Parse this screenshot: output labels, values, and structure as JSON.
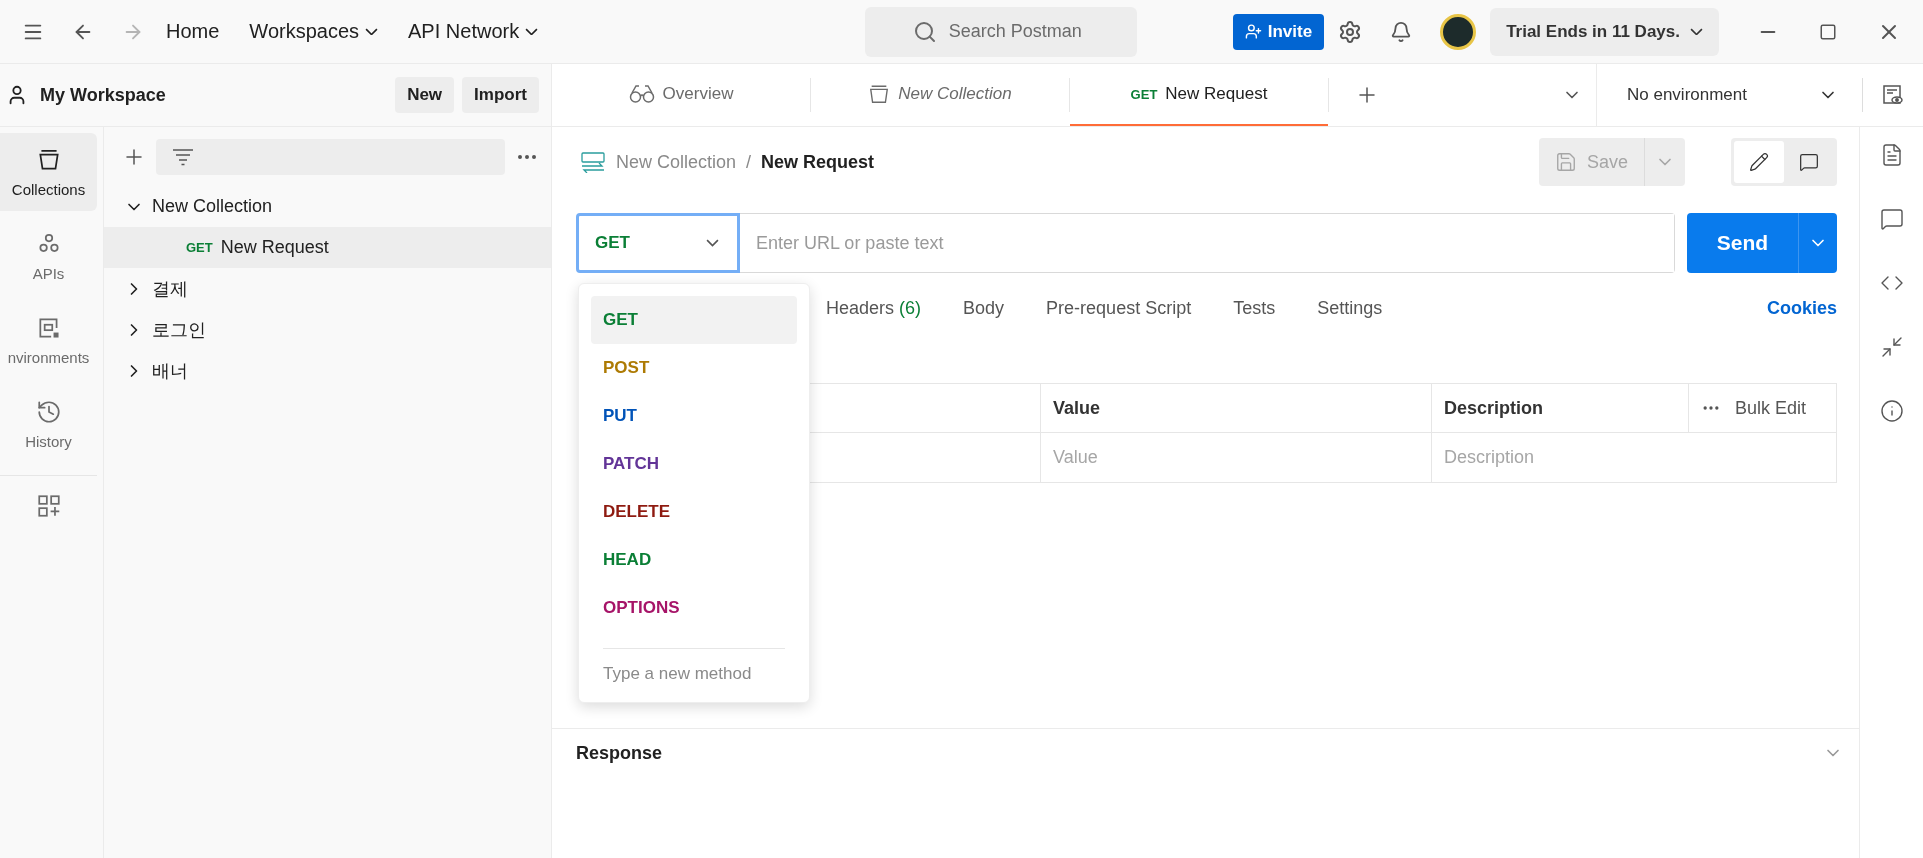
{
  "topbar": {
    "history_nav": [
      {
        "kind": "back",
        "disabled": false
      },
      {
        "kind": "forward",
        "disabled": true
      }
    ],
    "nav": [
      {
        "label": "Home",
        "dropdown": false
      },
      {
        "label": "Workspaces",
        "dropdown": true
      },
      {
        "label": "API Network",
        "dropdown": true
      }
    ],
    "search": {
      "placeholder": "Search Postman"
    },
    "invite": "Invite",
    "trial": "Trial Ends in 11 Days."
  },
  "workspace": {
    "title": "My Workspace",
    "buttons": [
      "New",
      "Import"
    ]
  },
  "rail": [
    {
      "kind": "collections",
      "label": "Collections",
      "selected": true
    },
    {
      "kind": "apis",
      "label": "APIs",
      "selected": false
    },
    {
      "kind": "environments",
      "label": "nvironments",
      "selected": false
    },
    {
      "kind": "history",
      "label": "History",
      "selected": false
    },
    {
      "kind": "apps",
      "selected": false
    }
  ],
  "tree": [
    {
      "label": "New Collection",
      "expanded": true,
      "children": [
        {
          "method": "GET",
          "label": "New Request",
          "selected": true
        }
      ]
    },
    {
      "label": "결제",
      "expanded": false
    },
    {
      "label": "로그인",
      "expanded": false
    },
    {
      "label": "배너",
      "expanded": false
    }
  ],
  "tabs": [
    {
      "kind": "overview",
      "label": "Overview",
      "selected": false
    },
    {
      "kind": "collection",
      "label": "New Collection",
      "selected": false
    },
    {
      "kind": "request",
      "method": "GET",
      "label": "New Request",
      "selected": true
    }
  ],
  "environment": "No environment",
  "breadcrumb": {
    "parent": "New Collection",
    "separator": "/",
    "current": "New Request"
  },
  "save": {
    "label": "Save",
    "disabled": true
  },
  "view_toggle": [
    {
      "kind": "edit",
      "selected": true
    },
    {
      "kind": "comments",
      "selected": false
    }
  ],
  "request": {
    "method": "GET",
    "url_placeholder": "Enter URL or paste text",
    "send": "Send"
  },
  "method_menu": {
    "open": true,
    "items": [
      {
        "label": "GET",
        "color": "#0b7f36",
        "selected": true
      },
      {
        "label": "POST",
        "color": "#ad7a03",
        "selected": false
      },
      {
        "label": "PUT",
        "color": "#0053b8",
        "selected": false
      },
      {
        "label": "PATCH",
        "color": "#623497",
        "selected": false
      },
      {
        "label": "DELETE",
        "color": "#8e1a10",
        "selected": false
      },
      {
        "label": "HEAD",
        "color": "#0b7f36",
        "selected": false
      },
      {
        "label": "OPTIONS",
        "color": "#a61468",
        "selected": false
      }
    ],
    "placeholder": "Type a new method"
  },
  "request_tabs": [
    {
      "label": "Headers",
      "count": "(6)"
    },
    {
      "label": "Body"
    },
    {
      "label": "Pre-request Script"
    },
    {
      "label": "Tests"
    },
    {
      "label": "Settings"
    }
  ],
  "cookies": "Cookies",
  "table": {
    "columns": [
      "Value",
      "Description"
    ],
    "bulk_edit": "Bulk Edit",
    "row": [
      "Value",
      "Description"
    ]
  },
  "response": {
    "title": "Response"
  }
}
